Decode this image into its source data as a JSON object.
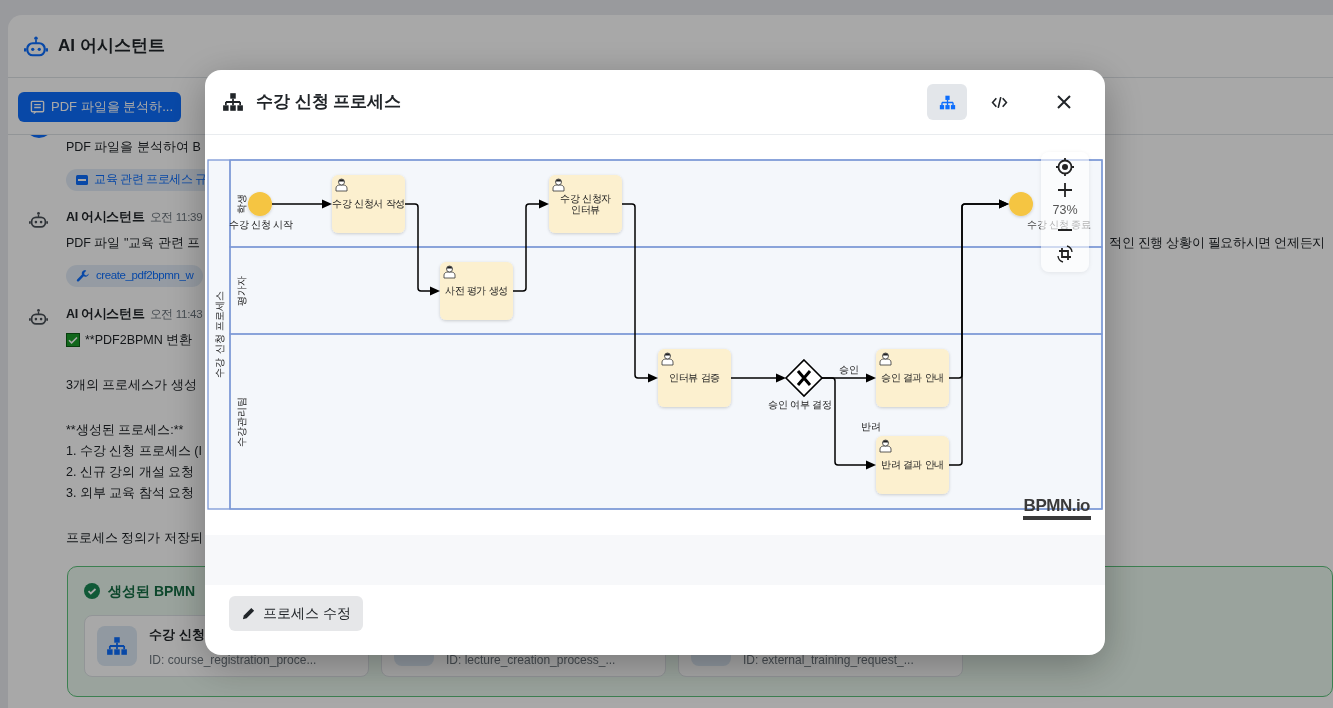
{
  "page": {
    "title": "AI 어시스턴트",
    "action_button": "PDF 파일을 분석하..."
  },
  "messages": [
    {
      "kind": "user",
      "paragraphs": [
        {
          "kind": "plain",
          "lines": [
            "PDF 파일을 분석하여 B"
          ]
        }
      ],
      "attachment": {
        "kind": "pdf",
        "label": "교육 관련 프로세스 규"
      }
    },
    {
      "kind": "assistant",
      "sender": "AI 어시스턴트",
      "time": "오전 11:39",
      "paragraphs": [
        {
          "kind": "plain",
          "lines": [
            "PDF 파일 \"교육 관련 프"
          ],
          "tail": "적인 진행 상황이 필요하시면 언제든지"
        }
      ],
      "attachment": {
        "kind": "tool",
        "label": "create_pdf2bpmn_w"
      }
    },
    {
      "kind": "assistant",
      "sender": "AI 어시스턴트",
      "time": "오전 11:43",
      "paragraphs": [
        {
          "kind": "check",
          "lines": [
            "**PDF2BPMN 변환"
          ]
        },
        {
          "kind": "plain",
          "lines": [
            "3개의 프로세스가 생성"
          ]
        },
        {
          "kind": "plain",
          "lines": [
            "**생성된 프로세스:**",
            "1. 수강 신청 프로세스 (I",
            "2. 신규 강의 개설 요청",
            "3. 외부 교육 참석 요청"
          ]
        },
        {
          "kind": "plain",
          "lines": [
            "프로세스 정의가 저장되"
          ]
        }
      ]
    }
  ],
  "result_panel": {
    "title": "생성된 BPMN",
    "cards": [
      {
        "name": "수강 신청",
        "id": "ID: course_registration_proce..."
      },
      {
        "id": "ID: lecture_creation_process_..."
      },
      {
        "id": "ID: external_training_request_..."
      }
    ]
  },
  "modal": {
    "title": "수강 신청 프로세스",
    "view_buttons": [
      {
        "kind": "diagram",
        "selected": true
      },
      {
        "kind": "code",
        "selected": false
      }
    ],
    "diagram": {
      "pool": "수강 신청 프로세스",
      "lanes": [
        "학생",
        "평가자",
        "수강관리팀"
      ],
      "nodes": [
        {
          "kind": "start",
          "label": [
            "수강 신청 시작"
          ]
        },
        {
          "kind": "user_task",
          "label": [
            "수강 신청서 작성"
          ]
        },
        {
          "kind": "user_task",
          "label": [
            "사전 평가 생성"
          ]
        },
        {
          "kind": "user_task",
          "label": [
            "수강 신청자",
            "인터뷰"
          ]
        },
        {
          "kind": "user_task",
          "label": [
            "인터뷰 검증"
          ]
        },
        {
          "kind": "gateway",
          "label": [
            "승인 여부 결정"
          ]
        },
        {
          "kind": "user_task",
          "label": [
            "승인 결과 안내"
          ]
        },
        {
          "kind": "user_task",
          "label": [
            "반려 결과 안내"
          ]
        },
        {
          "kind": "end",
          "label": [
            "수강 신청 종료"
          ]
        }
      ],
      "flow_labels": [
        "승인",
        "반려"
      ]
    },
    "zoom": "73%",
    "logo": "BPMN.io",
    "footer_button": "프로세스 수정"
  }
}
